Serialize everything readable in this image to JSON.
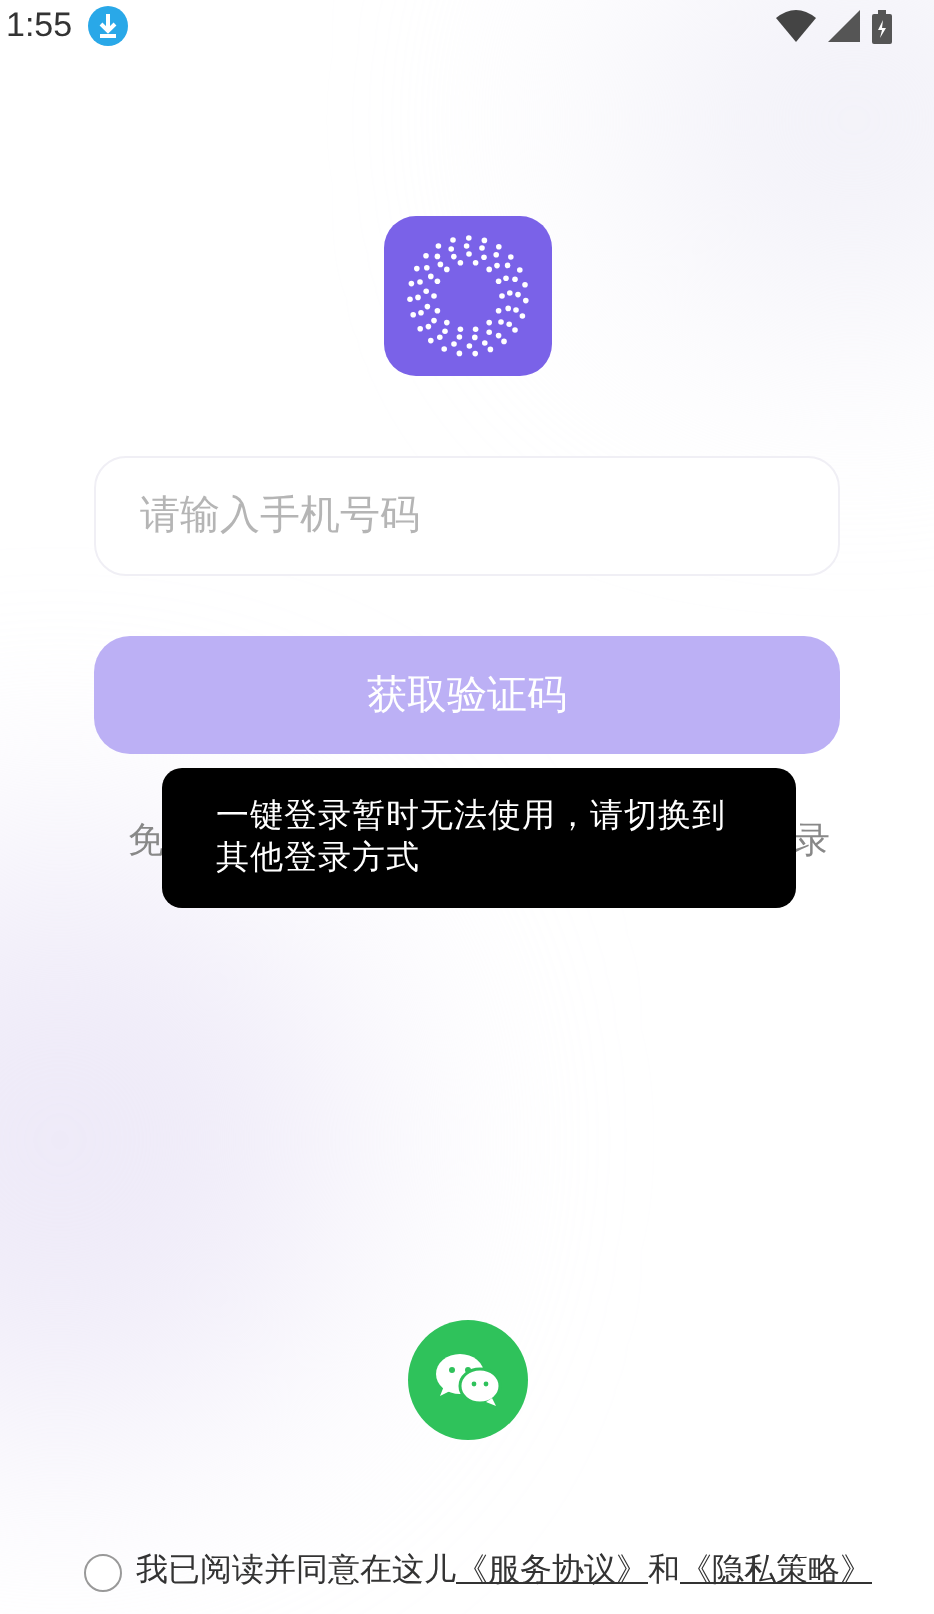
{
  "status_bar": {
    "time": "1:55"
  },
  "phone_field": {
    "placeholder": "请输入手机号码"
  },
  "code_button": {
    "label": "获取验证码",
    "disabled": true
  },
  "hidden_line": {
    "left_fragment": "免",
    "right_fragment": "录"
  },
  "toast": {
    "text": "一键登录暂时无法使用，请切换到其他登录方式"
  },
  "agreement": {
    "checked": false,
    "prefix": "我已阅读并同意在这儿",
    "terms_link": "《服务协议》",
    "joiner": "和",
    "privacy_link": "《隐私策略》"
  }
}
